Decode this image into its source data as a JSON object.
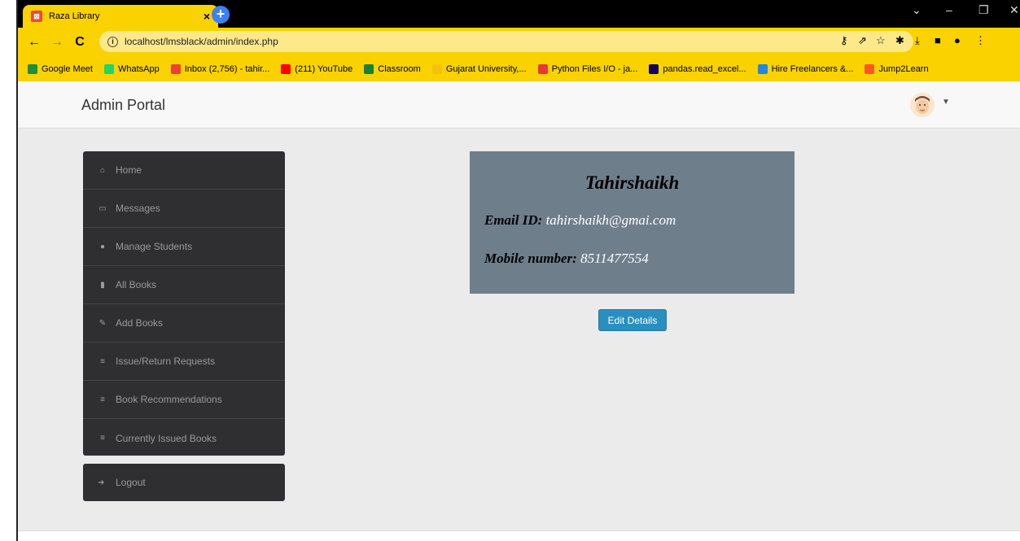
{
  "browser": {
    "tab_title": "Raza Library",
    "url": "localhost/lmsblack/admin/index.php",
    "bookmarks": [
      {
        "label": "Google Meet",
        "color": "#1e8e3e"
      },
      {
        "label": "WhatsApp",
        "color": "#25d366"
      },
      {
        "label": "Inbox (2,756) - tahir...",
        "color": "#ea4335"
      },
      {
        "label": "(211) YouTube",
        "color": "#ff0000"
      },
      {
        "label": "Classroom",
        "color": "#188038"
      },
      {
        "label": "Gujarat University,...",
        "color": "#f4c20d"
      },
      {
        "label": "Python Files I/O - ja...",
        "color": "#e53935"
      },
      {
        "label": "pandas.read_excel...",
        "color": "#150458"
      },
      {
        "label": "Hire Freelancers &...",
        "color": "#1e88e5"
      },
      {
        "label": "Jump2Learn",
        "color": "#ff5722"
      }
    ]
  },
  "header": {
    "brand": "Admin Portal"
  },
  "sidebar": {
    "items": [
      {
        "label": "Home",
        "icon": "home-icon"
      },
      {
        "label": "Messages",
        "icon": "inbox-icon"
      },
      {
        "label": "Manage Students",
        "icon": "user-icon"
      },
      {
        "label": "All Books",
        "icon": "book-icon"
      },
      {
        "label": "Add Books",
        "icon": "edit-icon"
      },
      {
        "label": "Issue/Return Requests",
        "icon": "list-icon"
      },
      {
        "label": "Book Recommendations",
        "icon": "list-icon"
      },
      {
        "label": "Currently Issued Books",
        "icon": "list-icon"
      }
    ],
    "logout": "Logout"
  },
  "profile": {
    "name": "Tahirshaikh",
    "email_label": "Email ID:",
    "email": "tahirshaikh@gmai.com",
    "mobile_label": "Mobile number:",
    "mobile": "8511477554",
    "edit_button": "Edit Details"
  },
  "colors": {
    "browser_accent": "#f9d200",
    "sidebar_bg": "#2f2f32",
    "card_bg": "#6f7e8b",
    "button_bg": "#2a8fbe"
  }
}
